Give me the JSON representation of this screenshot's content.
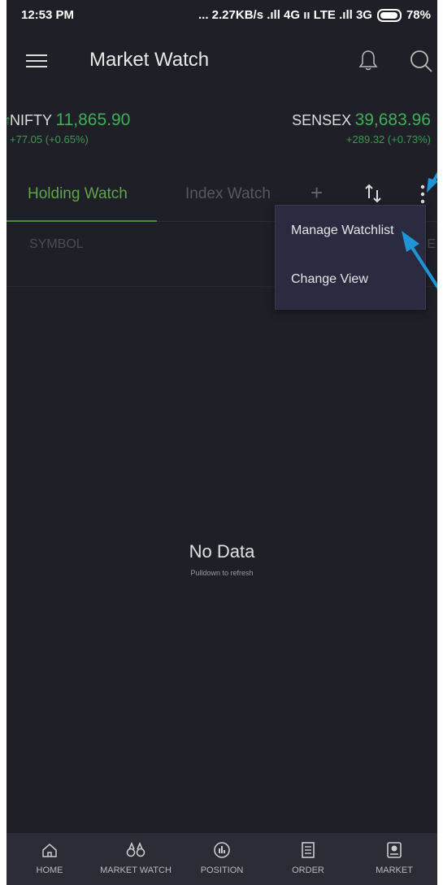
{
  "status_bar": {
    "time": "12:53 PM",
    "network": "... 2.27KB/s .ıll 4G ıı LTE .ıll 3G",
    "battery": "78%"
  },
  "app_bar": {
    "title": "Market Watch",
    "menu_icon": "hamburger-icon",
    "bell_icon": "bell-icon",
    "search_icon": "search-icon"
  },
  "ticker": {
    "nifty": {
      "name": "NIFTY",
      "value": "11,865.90",
      "change": "+77.05  (+0.65%)"
    },
    "sensex": {
      "name": "SENSEX",
      "value": "39,683.96",
      "change": "+289.32  (+0.73%)"
    }
  },
  "tabs": {
    "active": "Holding Watch",
    "inactive": "Index Watch",
    "add_label": "+"
  },
  "columns": {
    "symbol": "SYMBOL",
    "right": "E"
  },
  "menu": {
    "items": [
      "Manage Watchlist",
      "Change View"
    ]
  },
  "empty_state": {
    "title": "No Data",
    "subtitle": "Pulldown to refresh"
  },
  "bottom_nav": {
    "items": [
      "HOME",
      "MARKET WATCH",
      "POSITION",
      "ORDER",
      "MARKET"
    ]
  },
  "colors": {
    "background": "#1f2027",
    "positive": "#3fae5a",
    "negative": "#d64040",
    "annotation": "#1f95d8"
  }
}
